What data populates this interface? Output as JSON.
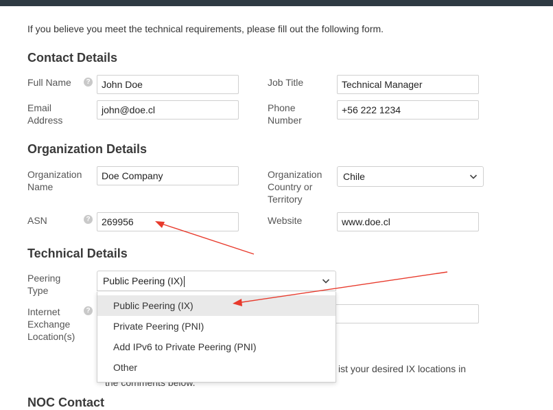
{
  "intro_text": "If you believe you meet the technical requirements, please fill out the following form.",
  "sections": {
    "contact": "Contact Details",
    "organization": "Organization Details",
    "technical": "Technical Details",
    "noc": "NOC Contact"
  },
  "contact": {
    "full_name_label": "Full Name",
    "full_name_value": "John Doe",
    "job_title_label": "Job Title",
    "job_title_value": "Technical Manager",
    "email_label_1": "Email",
    "email_label_2": "Address",
    "email_value": "john@doe.cl",
    "phone_label_1": "Phone",
    "phone_label_2": "Number",
    "phone_value": "+56 222 1234"
  },
  "organization": {
    "name_label_1": "Organization",
    "name_label_2": "Name",
    "name_value": "Doe Company",
    "country_label_1": "Organization",
    "country_label_2": "Country or",
    "country_label_3": "Territory",
    "country_value": "Chile",
    "asn_label": "ASN",
    "asn_value": "269956",
    "website_label": "Website",
    "website_value": "www.doe.cl"
  },
  "technical": {
    "peering_label_1": "Peering",
    "peering_label_2": "Type",
    "peering_value": "Public Peering (IX)",
    "ixl_label_1": "Internet",
    "ixl_label_2": "Exchange",
    "ixl_label_3": "Location(s)",
    "options": [
      "Public Peering (IX)",
      "Private Peering (PNI)",
      "Add IPv6 to Private Peering (PNI)",
      "Other"
    ],
    "hint_partial_1": "ist your desired IX locations in",
    "hint_partial_2": "the comments below."
  },
  "help_glyph": "?",
  "annotation_color": "#e8392b"
}
